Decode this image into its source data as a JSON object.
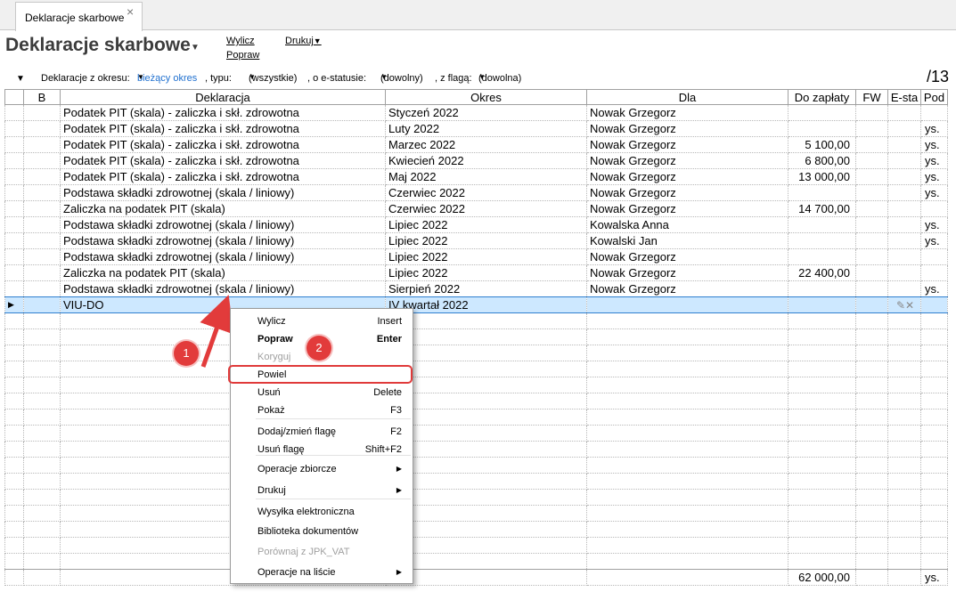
{
  "tab": {
    "label": "Deklaracje skarbowe",
    "close": "×"
  },
  "header": {
    "title": "Deklaracje skarbowe",
    "links": {
      "wylicz": "Wylicz",
      "popraw": "Popraw",
      "drukuj": "Drukuj"
    }
  },
  "filters": {
    "label_okres": "Deklaracje z okresu:",
    "okres_value": "bieżący okres",
    "label_typ": ", typu:",
    "typ_value": "(wszystkie)",
    "label_status": ", o e-statusie:",
    "status_value": "(dowolny)",
    "label_flaga": ", z flagą:",
    "flaga_value": "(dowolna)"
  },
  "count": "/13",
  "columns": [
    "",
    "B",
    "Deklaracja",
    "Okres",
    "Dla",
    "Do zapłaty",
    "FW",
    "E-sta",
    "Pod"
  ],
  "rows": [
    {
      "deklaracja": "Podatek PIT (skala) - zaliczka i skł. zdrowotna",
      "okres": "Styczeń 2022",
      "dla": "Nowak Grzegorz",
      "do_zaplaty": "",
      "pod": ""
    },
    {
      "deklaracja": "Podatek PIT (skala) - zaliczka i skł. zdrowotna",
      "okres": "Luty 2022",
      "dla": "Nowak Grzegorz",
      "do_zaplaty": "",
      "pod": "ys."
    },
    {
      "deklaracja": "Podatek PIT (skala) - zaliczka i skł. zdrowotna",
      "okres": "Marzec 2022",
      "dla": "Nowak Grzegorz",
      "do_zaplaty": "5 100,00",
      "pod": "ys."
    },
    {
      "deklaracja": "Podatek PIT (skala) - zaliczka i skł. zdrowotna",
      "okres": "Kwiecień 2022",
      "dla": "Nowak Grzegorz",
      "do_zaplaty": "6 800,00",
      "pod": "ys."
    },
    {
      "deklaracja": "Podatek PIT (skala) - zaliczka i skł. zdrowotna",
      "okres": "Maj 2022",
      "dla": "Nowak Grzegorz",
      "do_zaplaty": "13 000,00",
      "pod": "ys."
    },
    {
      "deklaracja": "Podstawa składki zdrowotnej (skala / liniowy)",
      "okres": "Czerwiec 2022",
      "dla": "Nowak Grzegorz",
      "do_zaplaty": "",
      "pod": "ys."
    },
    {
      "deklaracja": "Zaliczka na podatek PIT (skala)",
      "okres": "Czerwiec 2022",
      "dla": "Nowak Grzegorz",
      "do_zaplaty": "14 700,00",
      "pod": ""
    },
    {
      "deklaracja": "Podstawa składki zdrowotnej (skala / liniowy)",
      "okres": "Lipiec 2022",
      "dla": "Kowalska Anna",
      "do_zaplaty": "",
      "pod": "ys."
    },
    {
      "deklaracja": "Podstawa składki zdrowotnej (skala / liniowy)",
      "okres": "Lipiec 2022",
      "dla": "Kowalski Jan",
      "do_zaplaty": "",
      "pod": "ys."
    },
    {
      "deklaracja": "Podstawa składki zdrowotnej (skala / liniowy)",
      "okres": "Lipiec 2022",
      "dla": "Nowak Grzegorz",
      "do_zaplaty": "",
      "pod": ""
    },
    {
      "deklaracja": "Zaliczka na podatek PIT (skala)",
      "okres": "Lipiec 2022",
      "dla": "Nowak Grzegorz",
      "do_zaplaty": "22 400,00",
      "pod": ""
    },
    {
      "deklaracja": "Podstawa składki zdrowotnej (skala / liniowy)",
      "okres": "Sierpień 2022",
      "dla": "Nowak Grzegorz",
      "do_zaplaty": "",
      "pod": "ys."
    },
    {
      "deklaracja": "VIU-DO",
      "okres": "IV kwartał 2022",
      "dla": "",
      "do_zaplaty": "",
      "pod": "",
      "selected": true,
      "estatus_icon": "edit-cancel-icon"
    }
  ],
  "footer": {
    "total": "62 000,00",
    "pod": "ys."
  },
  "menu": {
    "items": [
      {
        "label": "Wylicz",
        "shortcut": "Insert"
      },
      {
        "label": "Popraw",
        "shortcut": "Enter",
        "bold": true
      },
      {
        "label": "Koryguj",
        "shortcut": "",
        "disabled": true
      },
      {
        "label": "Powiel",
        "shortcut": "",
        "highlighted": true
      },
      {
        "label": "Usuń",
        "shortcut": "Delete"
      },
      {
        "label": "Pokaż",
        "shortcut": "F3"
      },
      {
        "label": "Dodaj/zmień flagę",
        "shortcut": "F2"
      },
      {
        "label": "Usuń flagę",
        "shortcut": "Shift+F2"
      },
      {
        "label": "Operacje zbiorcze",
        "submenu": true
      },
      {
        "label": "Drukuj",
        "submenu": true
      },
      {
        "label": "Wysyłka elektroniczna"
      },
      {
        "label": "Biblioteka dokumentów"
      },
      {
        "label": "Porównaj z JPK_VAT",
        "disabled": true
      },
      {
        "label": "Operacje na liście",
        "submenu": true
      }
    ]
  },
  "annotations": {
    "badge1": "1",
    "badge2": "2",
    "accent": "#e23b3b"
  }
}
